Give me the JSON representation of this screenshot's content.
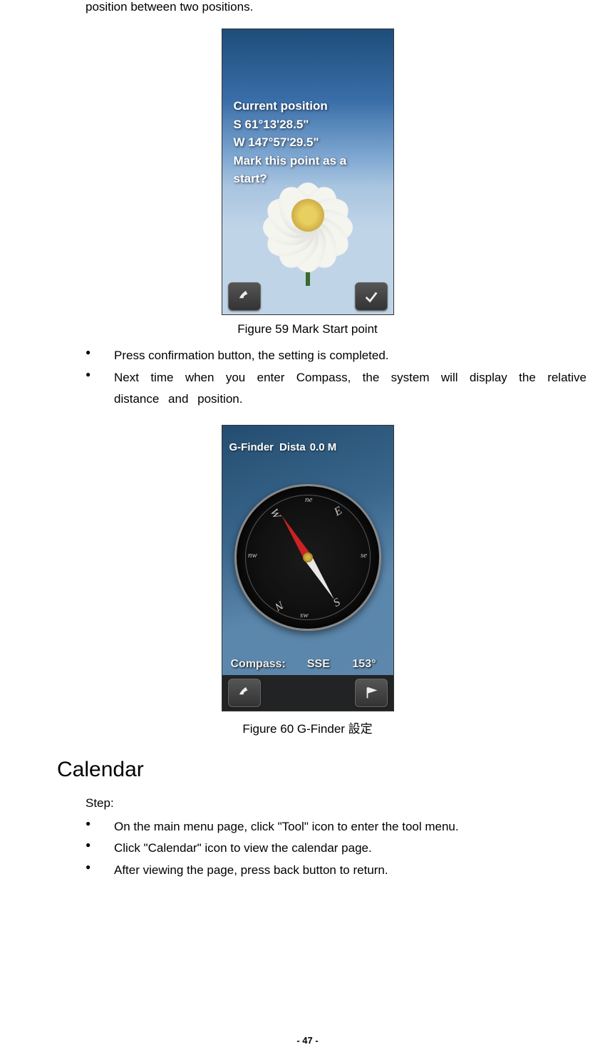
{
  "intro": "position between two positions.",
  "figure1": {
    "caption": "Figure 59 Mark Start point",
    "textblock": {
      "line1": "Current position",
      "line2": "S  61°13'28.5\"",
      "line3": "W 147°57'29.5\"",
      "line4": "Mark this point as a",
      "line5": "start?"
    },
    "back_button": "back",
    "confirm_button": "confirm"
  },
  "bullets1": {
    "b1": "Press confirmation button, the setting is completed.",
    "b2": "Next time when you enter Compass, the system will display the relative distance and position."
  },
  "figure2": {
    "caption": "Figure 60 G-Finder 設定",
    "header_label": "G-Finder",
    "header_dist_label": "Dista",
    "header_dist_value": "0.0 M",
    "compass_label": "Compass:",
    "compass_dir": "SSE",
    "compass_deg": "153°",
    "dirs": {
      "N": "N",
      "E": "E",
      "S": "S",
      "W": "W",
      "ne": "ne",
      "se": "se",
      "sw": "sw",
      "nw": "nw"
    },
    "back_button": "back",
    "flag_button": "flag"
  },
  "section_heading": "Calendar",
  "step_label": "Step:",
  "bullets2": {
    "b1": "On the main menu page, click \"Tool\" icon to enter the tool menu.",
    "b2": "Click \"Calendar\" icon to view the calendar page.",
    "b3": "After viewing the page, press back button to return."
  },
  "page_number": "- 47 -"
}
